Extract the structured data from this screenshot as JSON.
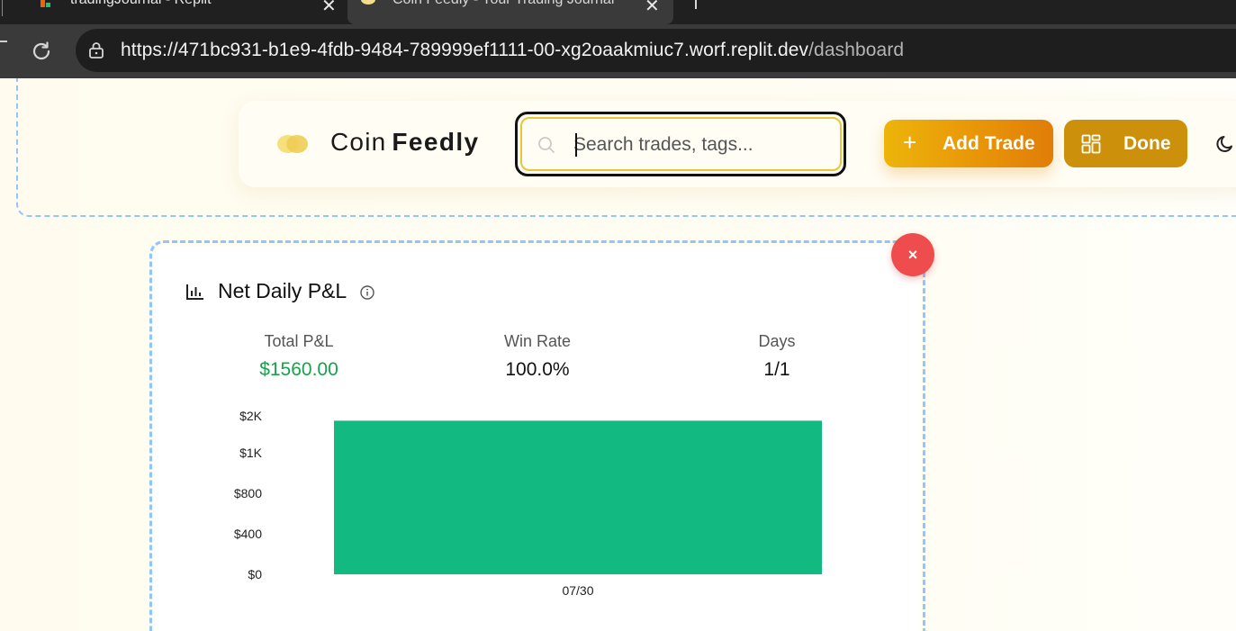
{
  "browser": {
    "tabs": [
      {
        "title": "tradingJournal - Replit",
        "active": false
      },
      {
        "title": "Coin Feedly - Your Trading Journal",
        "active": true
      }
    ],
    "url_main": "https://471bc931-b1e9-4fdb-9484-789999ef1111-00-xg2oaakmiuc7.worf.replit.dev",
    "url_path": "/dashboard"
  },
  "header": {
    "brand_light": "Coin",
    "brand_bold": "Feedly",
    "search_placeholder": "Search trades, tags...",
    "add_trade_label": "Add Trade",
    "done_label": "Done"
  },
  "widget": {
    "title": "Net Daily P&L",
    "remove_label": "×",
    "stats": {
      "total_label": "Total P&L",
      "total_value": "$1560.00",
      "win_label": "Win Rate",
      "win_value": "100.0%",
      "days_label": "Days",
      "days_value": "1/1"
    }
  },
  "colors": {
    "accent": "#e89308",
    "positive": "#16a34a",
    "bar": "#12b981",
    "danger": "#ef4d4d"
  },
  "chart_data": {
    "type": "bar",
    "categories": [
      "07/30"
    ],
    "values": [
      1560
    ],
    "ytick_labels": [
      "$0",
      "$400",
      "$800",
      "$1K",
      "$2K"
    ],
    "ytick_values": [
      0,
      400,
      800,
      1200,
      1600
    ],
    "ylim": [
      0,
      1600
    ],
    "title": "",
    "xlabel": "",
    "ylabel": "",
    "grid": false
  }
}
